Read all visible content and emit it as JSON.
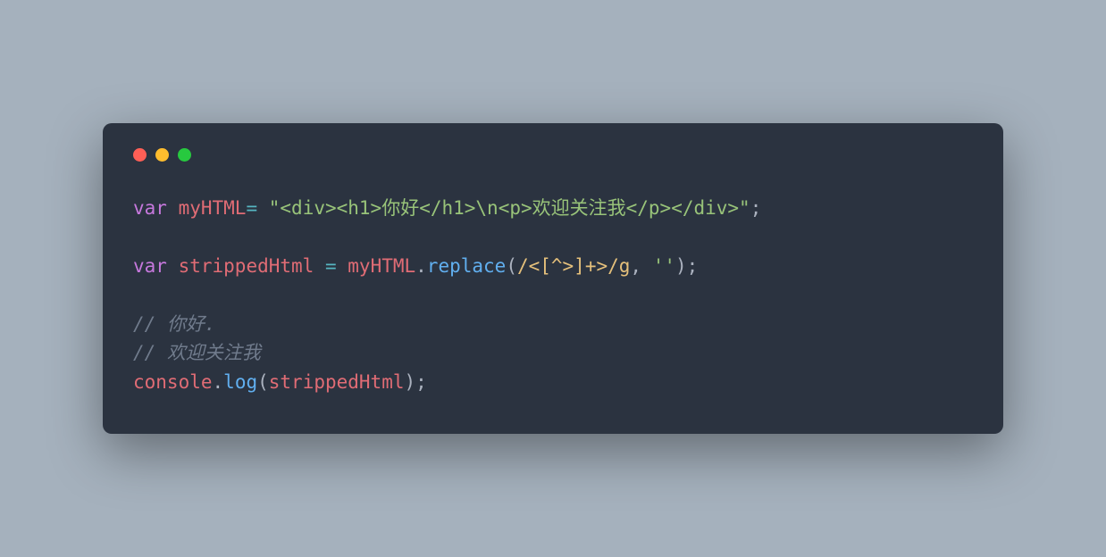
{
  "code": {
    "line1": {
      "kw": "var",
      "sp1": " ",
      "var": "myHTML",
      "op1": "=",
      "sp2": " ",
      "str": "\"<div><h1>你好</h1>\\n<p>欢迎关注我</p></div>\"",
      "semi": ";"
    },
    "line3": {
      "kw": "var",
      "sp1": " ",
      "var": "strippedHtml",
      "sp2": " ",
      "op1": "=",
      "sp3": " ",
      "obj": "myHTML",
      "dot": ".",
      "fn": "replace",
      "p1": "(",
      "regex": "/<[^>]+>/g",
      "comma": ", ",
      "str": "''",
      "p2": ")",
      "semi": ";"
    },
    "line5": "//  你好.",
    "line6": "// 欢迎关注我",
    "line7": {
      "obj": "console",
      "dot": ".",
      "fn": "log",
      "p1": "(",
      "arg": "strippedHtml",
      "p2": ")",
      "semi": ";"
    }
  }
}
